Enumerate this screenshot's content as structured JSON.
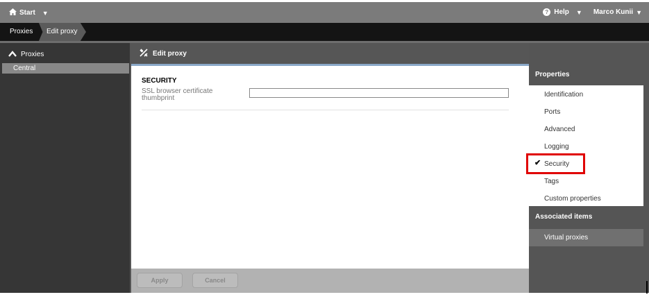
{
  "topbar": {
    "start_label": "Start",
    "help_label": "Help",
    "user_name": "Marco Kunii",
    "icons": {
      "home": "home-icon",
      "help": "help-circle-icon",
      "caret": "caret-down-icon"
    }
  },
  "breadcrumb": {
    "items": [
      "Proxies",
      "Edit proxy"
    ]
  },
  "sidebar": {
    "header": "Proxies",
    "items": [
      {
        "label": "Central",
        "selected": true
      }
    ]
  },
  "main": {
    "header_title": "Edit proxy",
    "section_title": "SECURITY",
    "fields": [
      {
        "label": "SSL browser certificate thumbprint",
        "value": "",
        "placeholder": ""
      }
    ],
    "buttons": {
      "apply": "Apply",
      "cancel": "Cancel"
    }
  },
  "properties": {
    "title": "Properties",
    "items": [
      {
        "label": "Identification"
      },
      {
        "label": "Ports"
      },
      {
        "label": "Advanced"
      },
      {
        "label": "Logging"
      },
      {
        "label": "Security",
        "checked": true
      },
      {
        "label": "Tags"
      },
      {
        "label": "Custom properties"
      }
    ],
    "associated_title": "Associated items",
    "associated_items": [
      {
        "label": "Virtual proxies"
      }
    ]
  },
  "colors": {
    "topbar": "#7b7b7b",
    "breadcrumb_bg": "#141414",
    "panel_bg": "#363636",
    "frame_bg": "#555555",
    "highlight_box": "#e00000",
    "content_accent": "#8aa8c8"
  }
}
